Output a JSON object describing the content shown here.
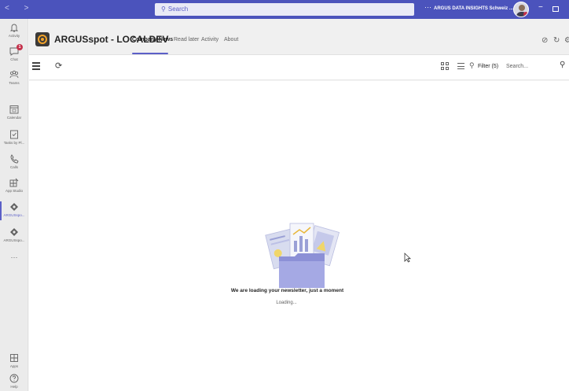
{
  "titlebar": {
    "search_placeholder": "Search",
    "more": "···",
    "org_name": "ARGUS DATA INSIGHTS Schweiz ...",
    "minimize": "−"
  },
  "rail": {
    "items": [
      {
        "label": "Activity",
        "icon": "bell-icon"
      },
      {
        "label": "Chat",
        "icon": "chat-icon",
        "badge": "1"
      },
      {
        "label": "Teams",
        "icon": "teams-icon"
      },
      {
        "label": "Calendar",
        "icon": "calendar-icon"
      },
      {
        "label": "Tasks by Pl...",
        "icon": "tasks-icon"
      },
      {
        "label": "Calls",
        "icon": "phone-icon"
      },
      {
        "label": "App Studio",
        "icon": "app-studio-icon"
      },
      {
        "label": "ARGUSspo...",
        "icon": "argus-icon"
      },
      {
        "label": "ARGUSspo...",
        "icon": "argus-icon"
      },
      {
        "label": "Apps",
        "icon": "apps-icon"
      },
      {
        "label": "Help",
        "icon": "help-icon"
      }
    ],
    "more": "···"
  },
  "app": {
    "title": "ARGUSspot - LOCALDEV",
    "tabs": [
      "Company News",
      "Read later",
      "Activity",
      "About"
    ],
    "active_tab": "Company News"
  },
  "toolbar": {
    "filter_label": "Filter (5)",
    "search_placeholder": "Search..."
  },
  "content": {
    "loading_title": "We are loading your newsletter, just a moment",
    "loading_sub": "Loading..."
  },
  "colors": {
    "titlebar": "#4b53bc",
    "accent": "#5b5fc7",
    "badge": "#c4314b",
    "brand_orange": "#f2a32a"
  }
}
